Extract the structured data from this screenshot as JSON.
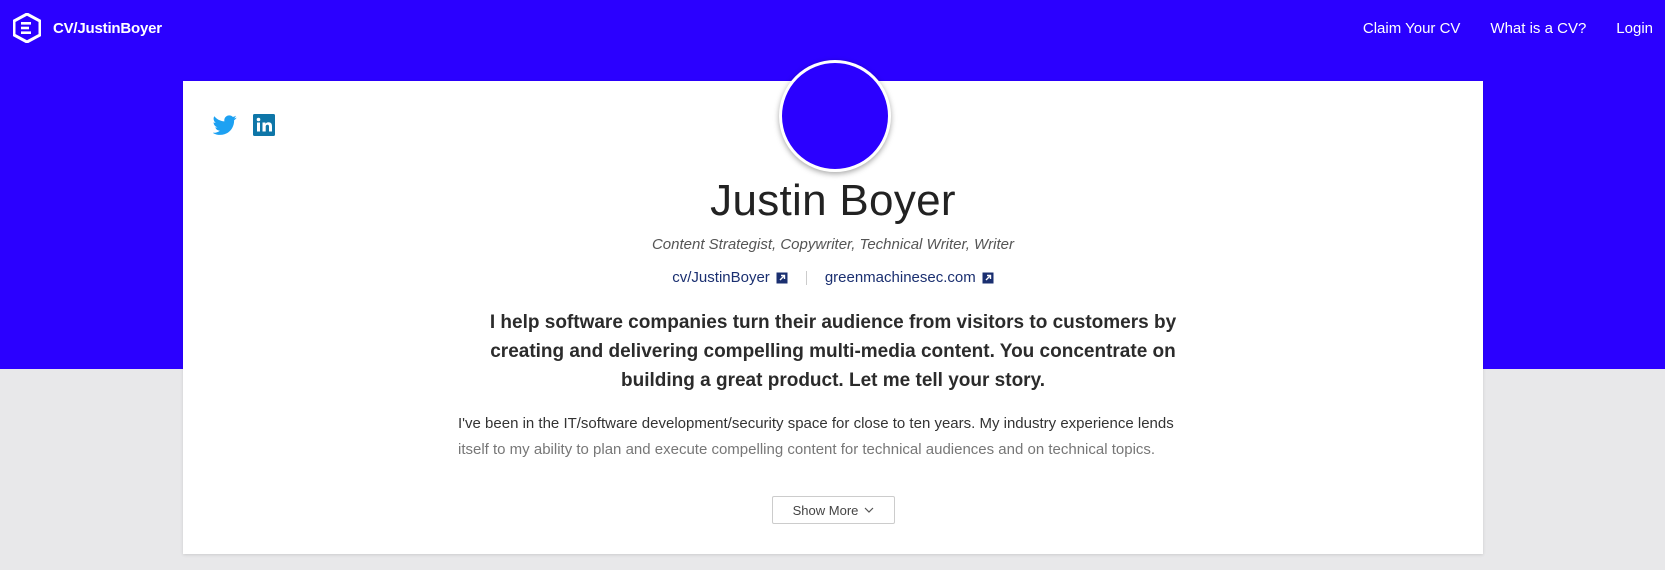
{
  "brand": {
    "name": "CV/JustinBoyer",
    "logo_icon": "cv-logo-icon"
  },
  "nav": [
    {
      "label": "Claim Your CV"
    },
    {
      "label": "What is a CV?"
    },
    {
      "label": "Login"
    }
  ],
  "colors": {
    "brand": "#2b00ff",
    "page_bg": "#e8e8ea",
    "link": "#1a2f70",
    "twitter": "#1da1f2",
    "linkedin": "#0e76a8"
  },
  "social": [
    {
      "icon": "twitter-icon"
    },
    {
      "icon": "linkedin-icon"
    }
  ],
  "profile": {
    "name": "Justin Boyer",
    "tagline": "Content Strategist, Copywriter, Technical Writer, Writer",
    "links": [
      {
        "label": "cv/JustinBoyer",
        "icon": "external-link-icon"
      },
      {
        "label": "greenmachinesec.com",
        "icon": "external-link-icon"
      }
    ],
    "headline": "I help software companies turn their audience from visitors to customers by creating and delivering compelling multi-media content. You concentrate on building a great product. Let me tell your story.",
    "bio_line1": "I've been in the IT/software development/security space for close to ten years. My industry experience lends",
    "bio_line2": "itself to my ability to plan and execute compelling content for technical audiences and on technical topics.",
    "show_more_label": "Show More"
  }
}
